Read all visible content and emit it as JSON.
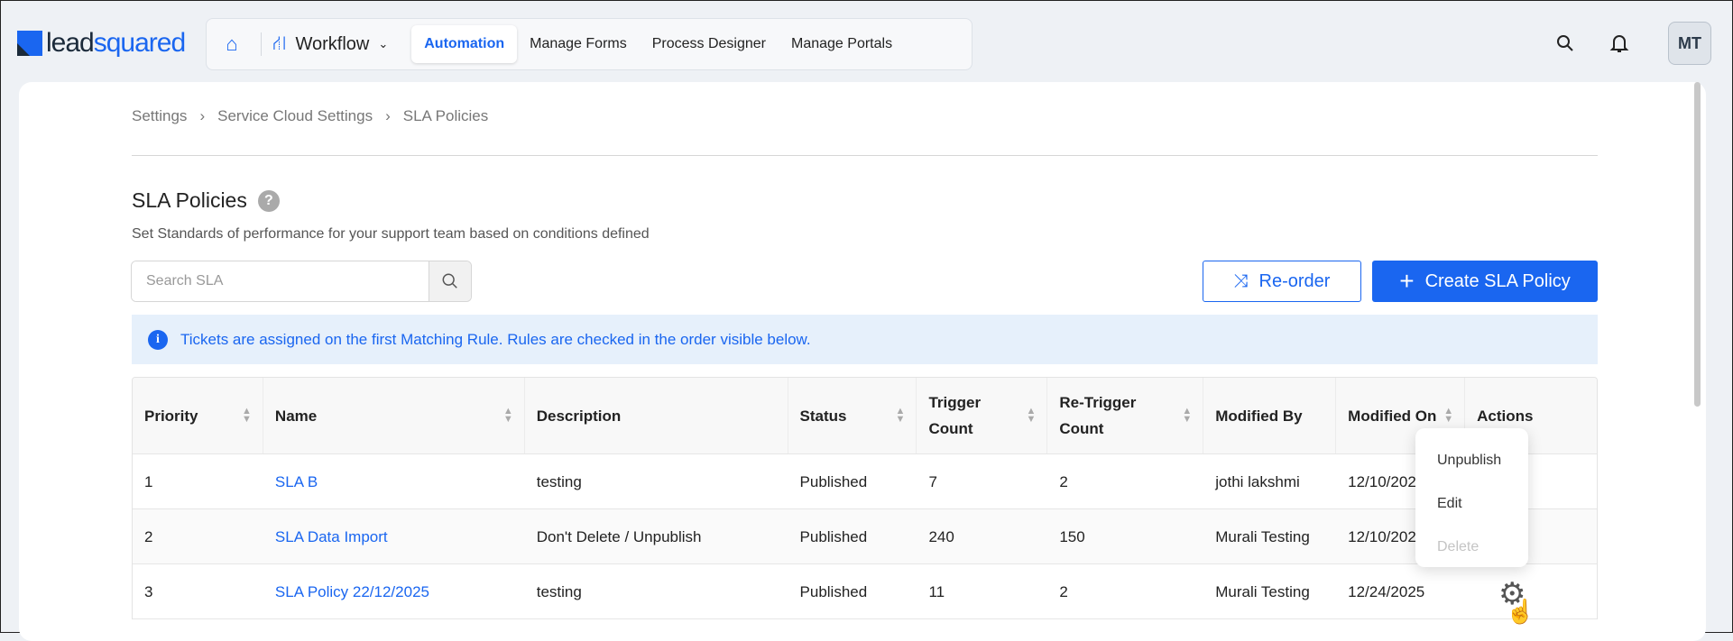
{
  "logo": {
    "text_a": "lead",
    "text_b": "squared"
  },
  "nav": {
    "module": "Workflow",
    "tabs": [
      {
        "label": "Automation",
        "active": true
      },
      {
        "label": "Manage Forms"
      },
      {
        "label": "Process Designer"
      },
      {
        "label": "Manage Portals"
      }
    ]
  },
  "user": {
    "initials": "MT"
  },
  "breadcrumb": [
    "Settings",
    "Service Cloud Settings",
    "SLA Policies"
  ],
  "page": {
    "title": "SLA Policies",
    "subtitle": "Set Standards of performance for your support team based on conditions defined"
  },
  "search": {
    "placeholder": "Search SLA",
    "value": ""
  },
  "buttons": {
    "reorder": "Re-order",
    "create": "Create SLA Policy"
  },
  "banner": "Tickets are assigned on the first Matching Rule. Rules are checked in the order visible below.",
  "table": {
    "columns": [
      "Priority",
      "Name",
      "Description",
      "Status",
      "Trigger Count",
      "Re-Trigger Count",
      "Modified By",
      "Modified On",
      "Actions"
    ],
    "rows": [
      [
        "1",
        "SLA B",
        "testing",
        "Published",
        "7",
        "2",
        "jothi lakshmi",
        "12/10/2025"
      ],
      [
        "2",
        "SLA Data Import",
        "Don't Delete / Unpublish",
        "Published",
        "240",
        "150",
        "Murali Testing",
        "12/10/2025"
      ],
      [
        "3",
        "SLA Policy 22/12/2025",
        "testing",
        "Published",
        "11",
        "2",
        "Murali Testing",
        "12/24/2025"
      ]
    ]
  },
  "action_menu": {
    "items": [
      {
        "label": "Unpublish"
      },
      {
        "label": "Edit"
      },
      {
        "label": "Delete",
        "disabled": true
      }
    ]
  },
  "colors": {
    "accent": "#1a66f0",
    "banner_bg": "#e6f0fb"
  }
}
